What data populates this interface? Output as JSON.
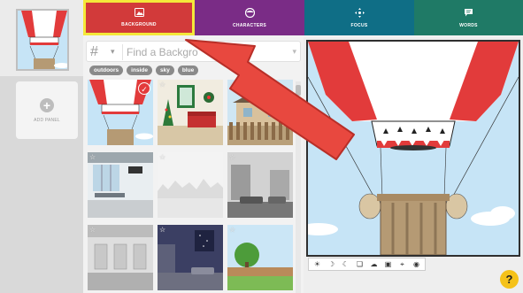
{
  "sidebar": {
    "add_panel_label": "ADD PANEL",
    "add_icon": "plus-icon"
  },
  "tabs": [
    {
      "label": "BACKGROUND",
      "icon": "image-icon",
      "color": "#d23a3a",
      "active": true
    },
    {
      "label": "CHARACTERS",
      "icon": "character-icon",
      "color": "#7a2c86"
    },
    {
      "label": "FOCUS",
      "icon": "focus-icon",
      "color": "#0f6e86"
    },
    {
      "label": "WORDS",
      "icon": "speech-bubble-icon",
      "color": "#1f7a66"
    }
  ],
  "search": {
    "hash_symbol": "#",
    "placeholder": "Find a Backgro"
  },
  "tags": [
    "outdoors",
    "inside",
    "sky",
    "blue"
  ],
  "backgrounds": [
    {
      "name": "hot air balloon",
      "selected": true
    },
    {
      "name": "christmas room"
    },
    {
      "name": "house with fence"
    },
    {
      "name": "airport terminal"
    },
    {
      "name": "white cityscape"
    },
    {
      "name": "gray street"
    },
    {
      "name": "gray hallway"
    },
    {
      "name": "night city"
    },
    {
      "name": "tree and fence"
    }
  ],
  "preview_tools": [
    "sun-icon",
    "moon-icon",
    "crescent-icon",
    "copy-icon",
    "cloud-icon",
    "image-icon",
    "crosshair-icon",
    "camera-icon"
  ],
  "help": {
    "label": "?"
  },
  "colors": {
    "accent_red": "#d23a3a",
    "highlight_yellow": "#f4e83a",
    "arrow_red": "#e8483f"
  }
}
